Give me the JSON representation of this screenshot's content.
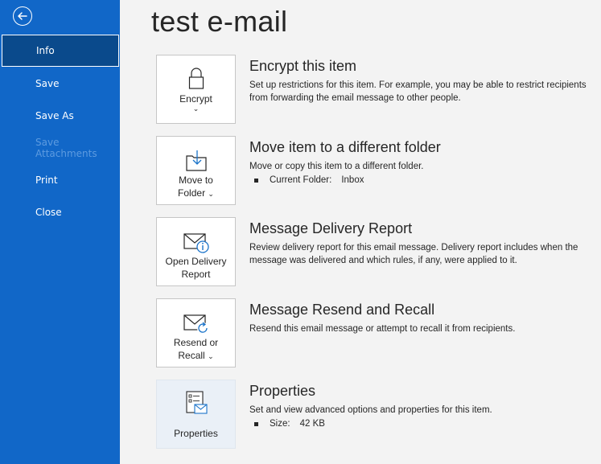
{
  "sidebar": {
    "back_label": "Back",
    "items": [
      {
        "label": "Info"
      },
      {
        "label": "Save"
      },
      {
        "label": "Save As"
      },
      {
        "label": "Save Attachments"
      },
      {
        "label": "Print"
      },
      {
        "label": "Close"
      }
    ]
  },
  "main": {
    "title": "test e-mail",
    "sections": [
      {
        "tile_label_1": "Encrypt",
        "title": "Encrypt this item",
        "description": "Set up restrictions for this item. For example, you may be able to restrict recipients from forwarding the email message to other people."
      },
      {
        "tile_label_1": "Move to",
        "tile_label_2": "Folder",
        "title": "Move item to a different folder",
        "description": "Move or copy this item to a different folder.",
        "bullet_label": "Current Folder:",
        "bullet_value": "Inbox"
      },
      {
        "tile_label_1": "Open Delivery",
        "tile_label_2": "Report",
        "title": "Message Delivery Report",
        "description": "Review delivery report for this email message. Delivery report includes when the message was delivered and which rules, if any, were applied to it."
      },
      {
        "tile_label_1": "Resend or",
        "tile_label_2": "Recall",
        "title": "Message Resend and Recall",
        "description": "Resend this email message or attempt to recall it from recipients."
      },
      {
        "tile_label_1": "Properties",
        "title": "Properties",
        "description": "Set and view advanced options and properties for this item.",
        "bullet_label": "Size:",
        "bullet_value": "42 KB"
      }
    ]
  },
  "colors": {
    "sidebar_bg": "#1167c8",
    "active_item_bg": "#0a4a8c",
    "disabled_text": "#5d9be0",
    "page_bg": "#f3f3f3"
  },
  "icons": {
    "back": "arrow-left-circle-icon",
    "encrypt": "lock-icon",
    "move": "folder-move-icon",
    "delivery": "envelope-info-icon",
    "resend": "envelope-refresh-icon",
    "properties": "properties-list-icon"
  }
}
